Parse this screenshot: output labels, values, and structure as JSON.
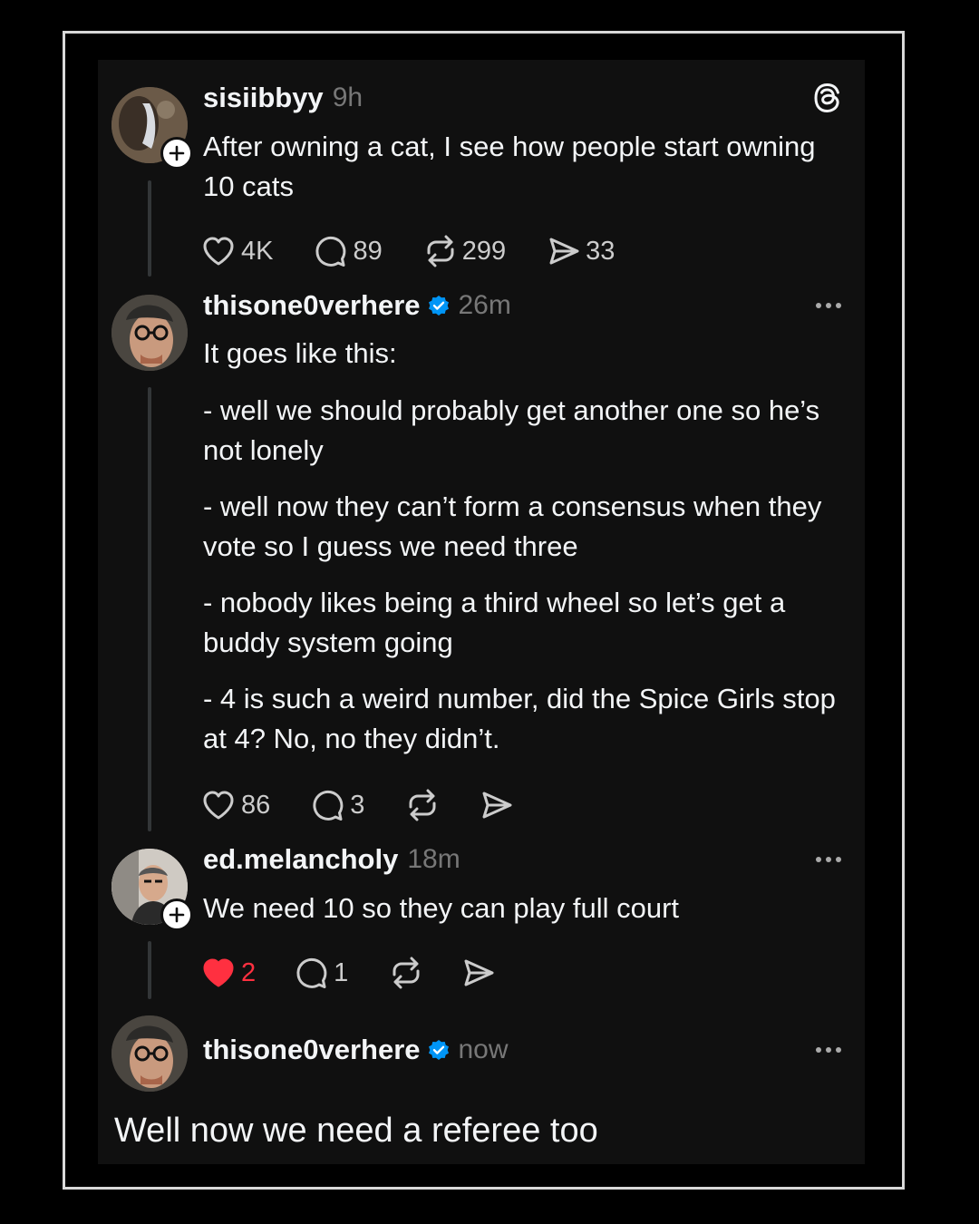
{
  "app": {
    "logo_icon": "threads-logo-icon"
  },
  "posts": [
    {
      "username": "sisiibbyy",
      "time": "9h",
      "verified": false,
      "text_lines": [
        "After owning a cat, I see how people start owning 10 cats"
      ],
      "stats": {
        "likes": "4K",
        "replies": "89",
        "reposts": "299",
        "shares": "33"
      }
    },
    {
      "username": "thisone0verhere",
      "time": "26m",
      "verified": true,
      "text_lines": [
        "It goes like this:",
        "- well we should probably get another one so he’s not lonely",
        "- well now they can’t form a consensus when they vote so I guess we need three",
        "- nobody likes being a third wheel so let’s get a buddy system going",
        "- 4 is such a weird number, did the Spice Girls stop at 4? No, no they didn’t."
      ],
      "stats": {
        "likes": "86",
        "replies": "3"
      }
    },
    {
      "username": "ed.melancholy",
      "time": "18m",
      "verified": false,
      "text_lines": [
        "We need 10 so they can play full court"
      ],
      "stats": {
        "likes": "2",
        "replies": "1"
      },
      "liked": true
    },
    {
      "username": "thisone0verhere",
      "time": "now",
      "verified": true,
      "text_lines": [
        "Well now we need a referee too"
      ]
    }
  ],
  "colors": {
    "background": "#101010",
    "verified": "#0095f6",
    "liked": "#ff3040",
    "muted": "#777777"
  }
}
